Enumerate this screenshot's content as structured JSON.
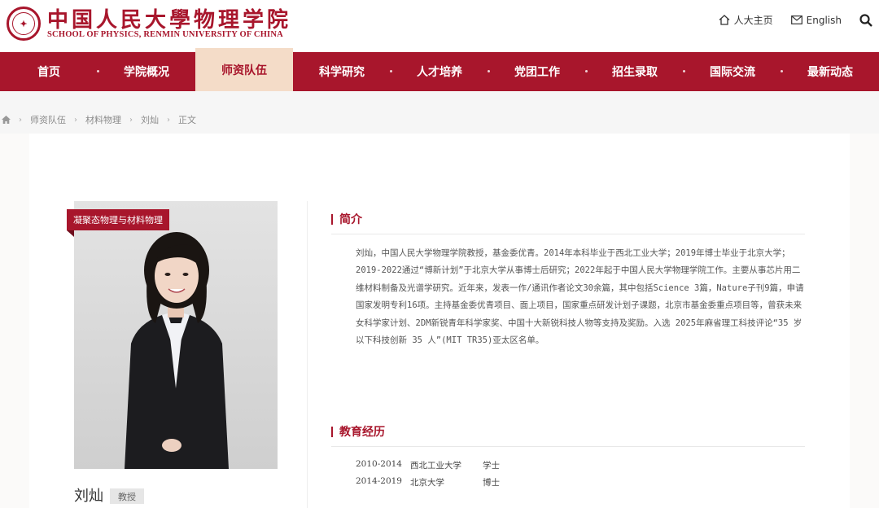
{
  "header": {
    "logo_cn": "中国人民大學物理学院",
    "logo_en": "SCHOOL OF PHYSICS, RENMIN UNIVERSITY OF CHINA",
    "links": [
      {
        "label": "人大主页",
        "icon": "home-icon"
      },
      {
        "label": "English",
        "icon": "mail-icon"
      }
    ],
    "search_icon": "search-icon"
  },
  "nav": {
    "items": [
      "首页",
      "学院概况",
      "师资队伍",
      "科学研究",
      "人才培养",
      "党团工作",
      "招生录取",
      "国际交流",
      "最新动态"
    ],
    "active_index": 2
  },
  "breadcrumb": {
    "home_icon": "home-icon",
    "items": [
      "师资队伍",
      "材料物理",
      "刘灿",
      "正文"
    ]
  },
  "profile": {
    "tag": "凝聚态物理与材料物理",
    "name": "刘灿",
    "title": "教授"
  },
  "sections": {
    "intro_title": "简介",
    "intro_text": "刘灿，中国人民大学物理学院教授，基金委优青。2014年本科毕业于西北工业大学；2019年博士毕业于北京大学；2019-2022通过“博新计划”于北京大学从事博士后研究；2022年起于中国人民大学物理学院工作。主要从事芯片用二维材料制备及光谱学研究。近年来，发表一作/通讯作者论文30余篇，其中包括Science 3篇，Nature子刊9篇，申请国家发明专利16项。主持基金委优青项目、面上项目，国家重点研发计划子课题，北京市基金委重点项目等，曾获未来女科学家计划、2DM新锐青年科学家奖、中国十大新锐科技人物等支持及奖励。入选 2025年麻省理工科技评论“35 岁以下科技创新 35 人”(MIT TR35)亚太区名单。",
    "edu_title": "教育经历",
    "education": [
      {
        "years": "2010-2014",
        "school": "西北工业大学",
        "degree": "学士"
      },
      {
        "years": "2014-2019",
        "school": "北京大学",
        "degree": "博士"
      }
    ]
  },
  "colors": {
    "brand": "#a8162c",
    "nav_active_bg": "#f4dcc8"
  }
}
